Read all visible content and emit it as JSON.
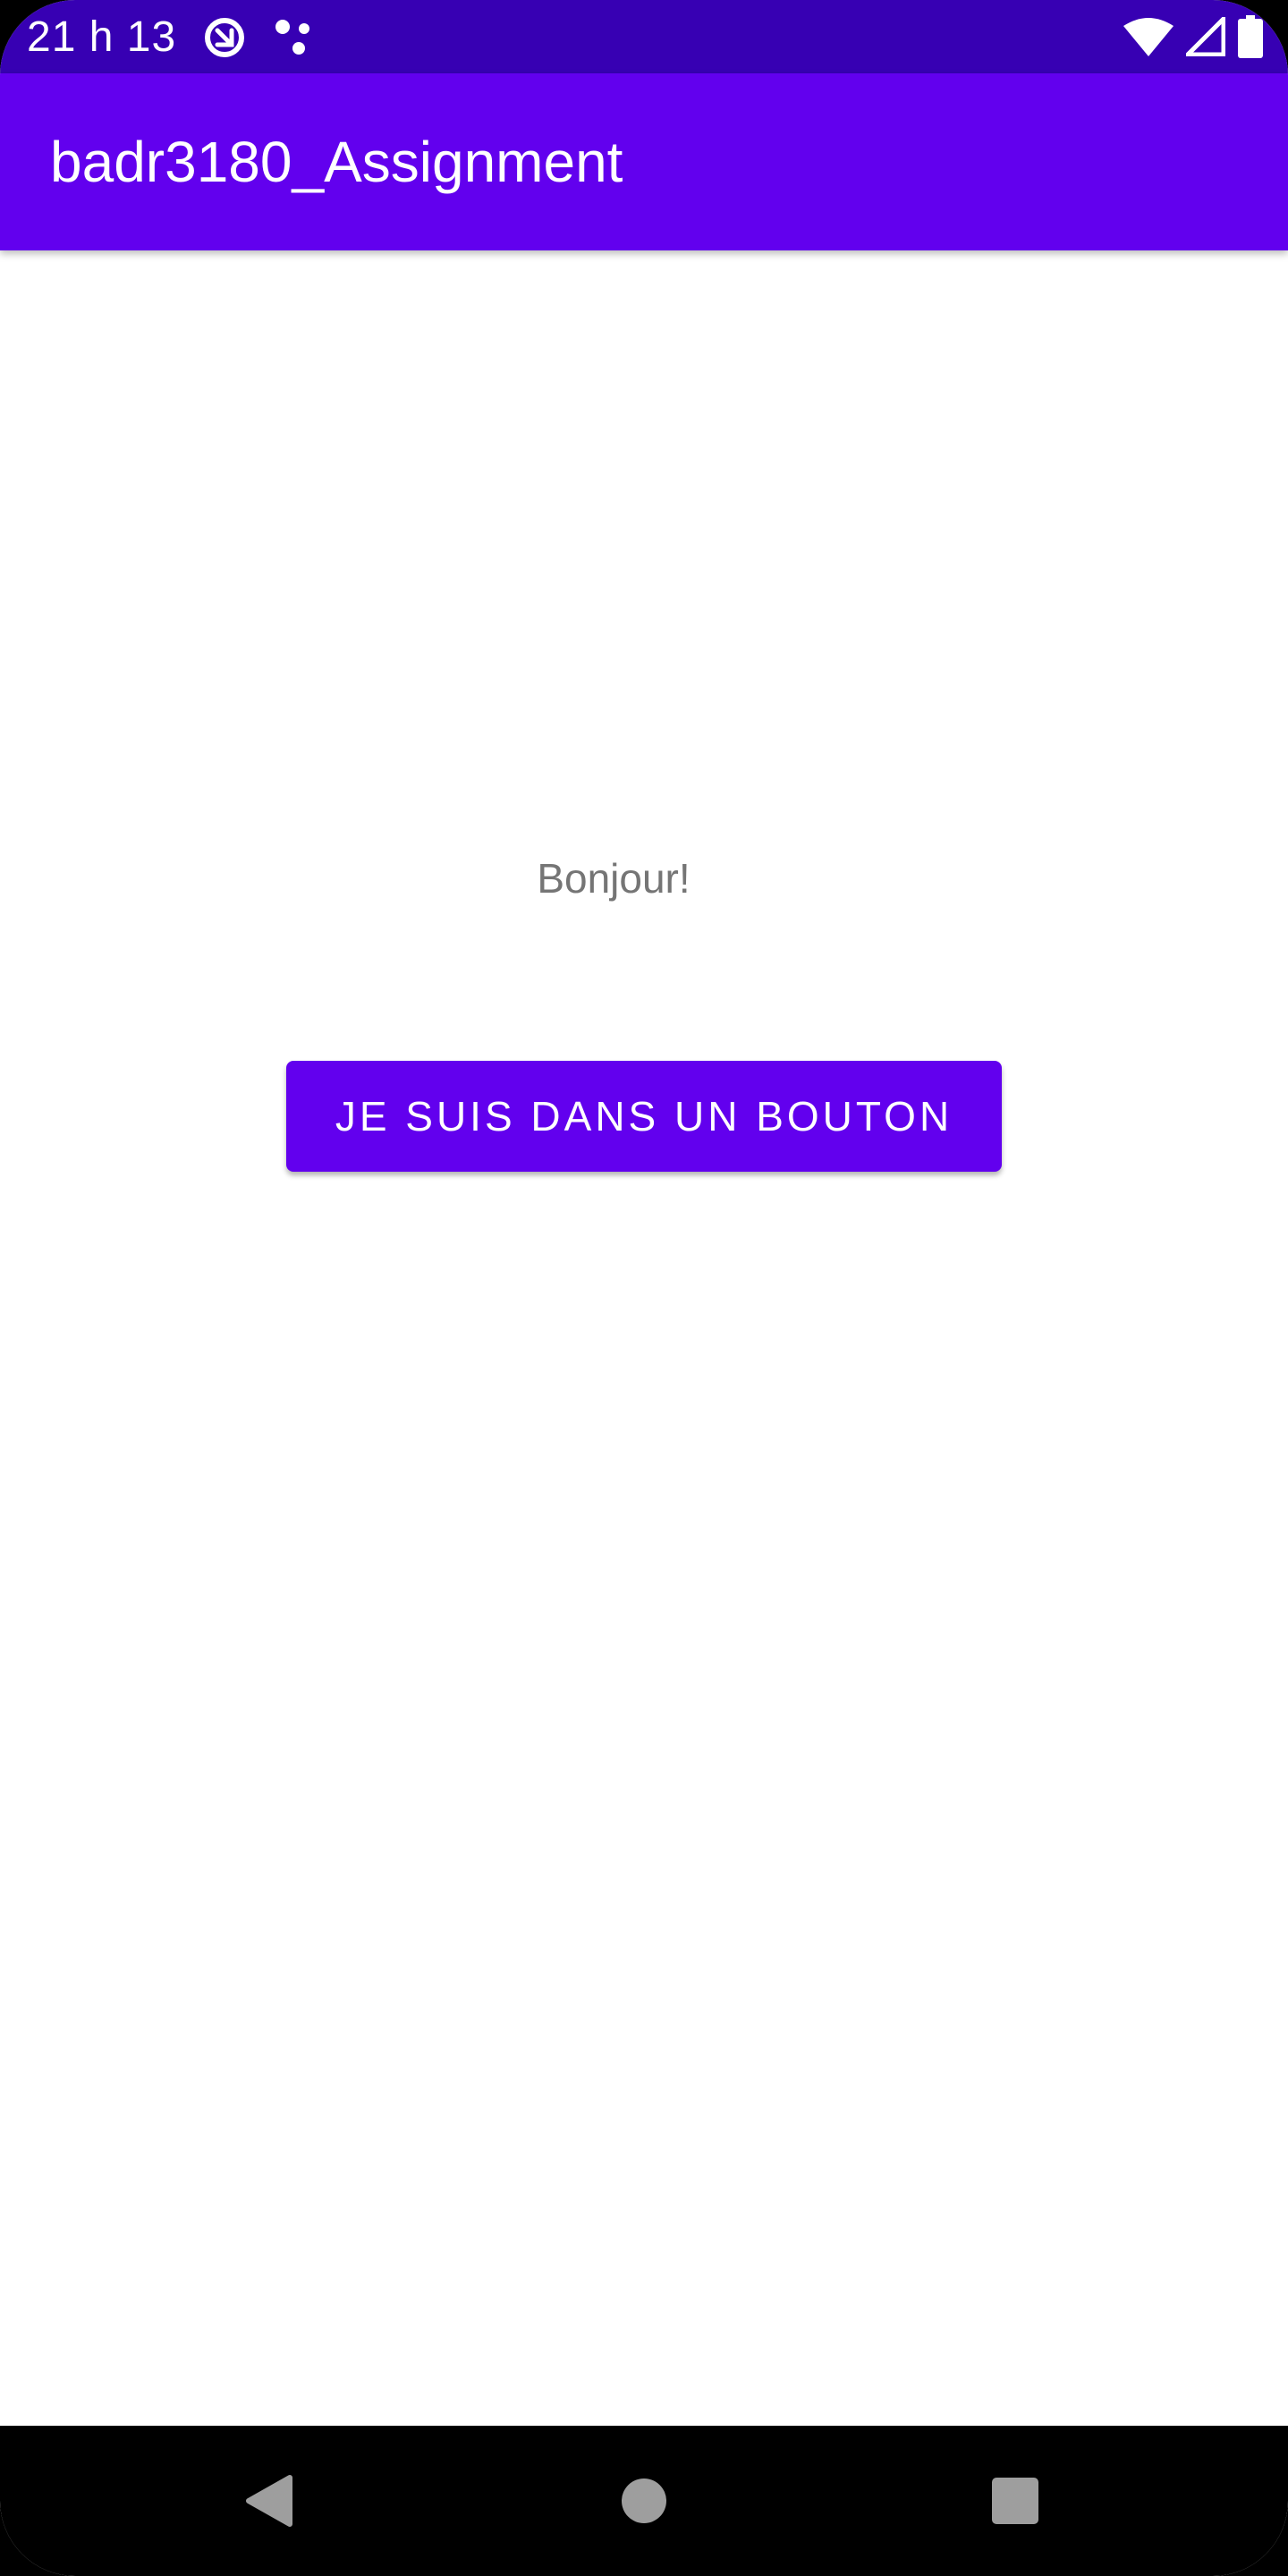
{
  "status_bar": {
    "time": "21 h 13",
    "icons": [
      "data-saver-icon",
      "notification-dots-icon",
      "wifi-icon",
      "signal-icon",
      "battery-icon"
    ]
  },
  "app_bar": {
    "title": "badr3180_Assignment"
  },
  "main": {
    "greeting": "Bonjour!",
    "button_label": "JE SUIS DANS UN BOUTON"
  },
  "nav_bar": {
    "icons": [
      "back-icon",
      "home-icon",
      "recents-icon"
    ]
  },
  "colors": {
    "status_bar": "#3700b3",
    "primary": "#6200ee",
    "greeting_text": "#757575",
    "nav_bar": "#000000",
    "nav_icon": "#9e9e9e"
  }
}
